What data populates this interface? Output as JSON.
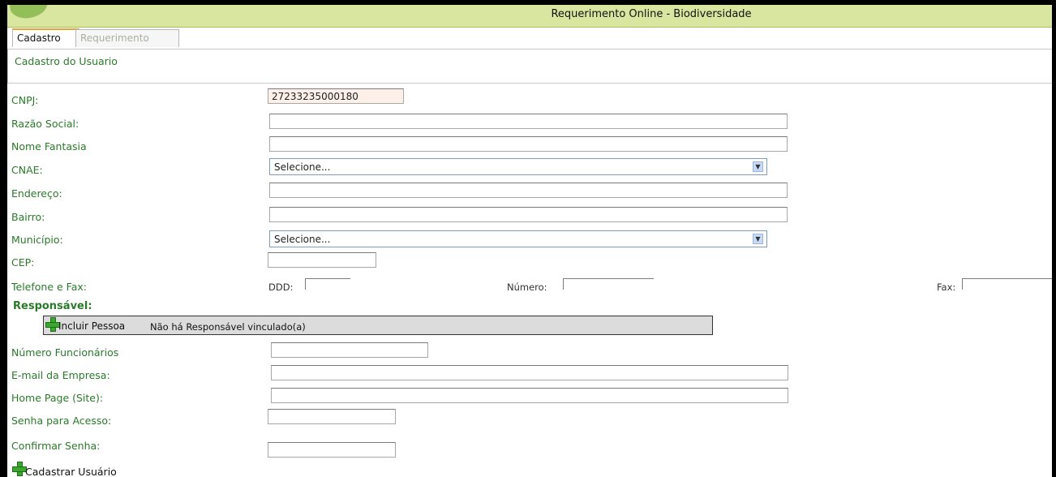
{
  "window": {
    "title": "Requerimento Online - Biodiversidade"
  },
  "tabs": [
    {
      "label": "Cadastro",
      "active": true
    },
    {
      "label": "Requerimento",
      "active": false
    }
  ],
  "section_title": "Cadastro do Usuario",
  "form": {
    "cnpj": {
      "label": "CNPJ:",
      "value": "27233235000180"
    },
    "razao_social": {
      "label": "Razão Social:",
      "value": ""
    },
    "nome_fantasia": {
      "label": "Nome Fantasia",
      "value": ""
    },
    "cnae": {
      "label": "CNAE:",
      "selected": "Selecione..."
    },
    "endereco": {
      "label": "Endereço:",
      "value": ""
    },
    "bairro": {
      "label": "Bairro:",
      "value": ""
    },
    "municipio": {
      "label": "Município:",
      "selected": "Selecione..."
    },
    "cep": {
      "label": "CEP:",
      "value": ""
    },
    "telefone": {
      "label": "Telefone e Fax:",
      "ddd_label": "DDD:",
      "numero_label": "Número:",
      "fax_label": "Fax:"
    },
    "numero_funcionarios": {
      "label": "Número Funcionários",
      "value": ""
    },
    "email": {
      "label": "E-mail da Empresa:",
      "value": ""
    },
    "home_page": {
      "label": "Home Page (Site):",
      "value": ""
    },
    "senha": {
      "label": "Senha para Acesso:",
      "value": ""
    },
    "confirmar_senha": {
      "label": "Confirmar Senha:",
      "value": ""
    }
  },
  "responsavel": {
    "title": "Responsável:",
    "add_label": "Incluir Pessoa",
    "status": "Não há Responsável vinculado(a)"
  },
  "submit_label": "Cadastrar Usuário",
  "colors": {
    "label_green": "#2a7a2a",
    "titlebar": "#d8e6a0",
    "plus_green": "#3aa82c"
  }
}
